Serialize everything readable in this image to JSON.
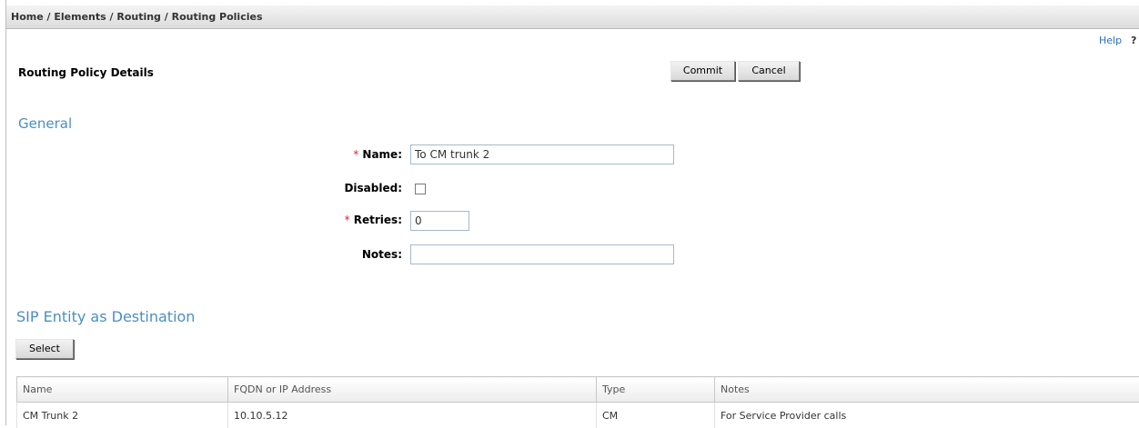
{
  "breadcrumb": "Home / Elements / Routing / Routing Policies",
  "help": {
    "label": "Help",
    "icon": "?"
  },
  "page_title": "Routing Policy Details",
  "buttons": {
    "commit": "Commit",
    "cancel": "Cancel",
    "select": "Select"
  },
  "general": {
    "title": "General",
    "name_label": "Name:",
    "name_value": "To CM trunk 2",
    "disabled_label": "Disabled:",
    "disabled_checked": false,
    "retries_label": "Retries:",
    "retries_value": "0",
    "notes_label": "Notes:",
    "notes_value": "",
    "required_marker": "*"
  },
  "sip_section": {
    "title": "SIP Entity as Destination",
    "columns": [
      "Name",
      "FQDN or IP Address",
      "Type",
      "Notes"
    ],
    "rows": [
      [
        "CM Trunk 2",
        "10.10.5.12",
        "CM",
        "For Service Provider calls"
      ]
    ]
  },
  "colors": {
    "section_title": "#4a8fc4",
    "required": "#d22233",
    "link": "#2a6ebb"
  }
}
